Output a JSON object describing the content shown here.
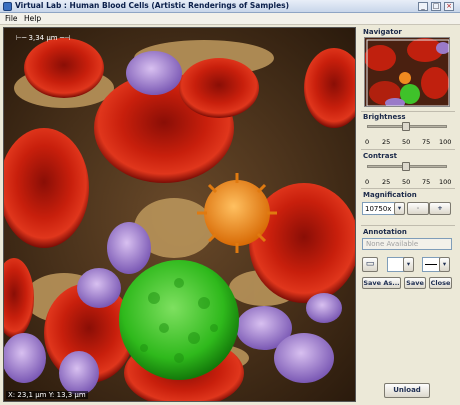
{
  "window": {
    "title": "Virtual Lab : Human Blood Cells (Artistic Renderings of Samples)"
  },
  "menu": {
    "file": "File",
    "help": "Help"
  },
  "viewer": {
    "scale_label": "3,34 µm",
    "coordinates": "X: 23,1 µm   Y: 13,3 µm"
  },
  "navigator": {
    "title": "Navigator"
  },
  "brightness": {
    "title": "Brightness",
    "ticks": [
      "0",
      "25",
      "50",
      "75",
      "100"
    ],
    "value": 50
  },
  "contrast": {
    "title": "Contrast",
    "ticks": [
      "0",
      "25",
      "50",
      "75",
      "100"
    ],
    "value": 50
  },
  "magnification": {
    "title": "Magnification",
    "value": "10750x",
    "minus": "-",
    "plus": "+"
  },
  "annotation": {
    "title": "Annotation",
    "select_value": "None Available"
  },
  "buttons": {
    "save_as": "Save As...",
    "save": "Save",
    "close": "Close",
    "unload": "Unload"
  }
}
